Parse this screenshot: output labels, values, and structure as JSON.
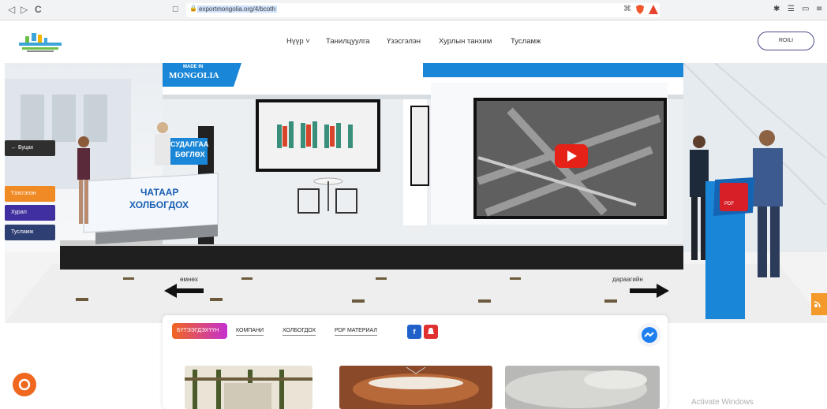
{
  "browser": {
    "url": "exportmongolia.org/4/bcoth",
    "back_glyph": "◁",
    "forward_glyph": "▷",
    "reload_glyph": "C"
  },
  "header": {
    "nav": [
      {
        "label": "Нүүр ˅"
      },
      {
        "label": "Танилцуулга"
      },
      {
        "label": "Үзэсгэлэн"
      },
      {
        "label": "Хурлын танхим"
      },
      {
        "label": "Тусламж"
      }
    ],
    "login_label": "ROILI"
  },
  "booth": {
    "banner_top": "MADE IN",
    "banner_main": "MONGOLIA",
    "research_line1": "СУДАЛГАА",
    "research_line2": "БӨГЛӨХ",
    "contact_line1": "ЧАТААР",
    "contact_line2": "ХОЛБОГДОХ",
    "pdf_label": "PDF",
    "prev_label": "өмнөх",
    "next_label": "дараагийн"
  },
  "sidebar": {
    "back_label": "← Буцах",
    "items": [
      {
        "label": "Үзэсгэлэн",
        "color": "#f08a24"
      },
      {
        "label": "Хурал",
        "color": "#3f2fa0"
      },
      {
        "label": "Тусламж",
        "color": "#2e3f73"
      }
    ]
  },
  "tabs": [
    {
      "label": "БҮТЭЭГДЭХҮҮН"
    },
    {
      "label": "КОМПАНИ"
    },
    {
      "label": "ХОЛБОГДОХ"
    },
    {
      "label": "PDF МАТЕРИАЛ"
    }
  ],
  "windows_watermark": "Activate Windows",
  "colors": {
    "accent_orange": "#f08a24",
    "brand_blue": "#1a86d8",
    "tab_active_start": "#f0671f",
    "tab_active_end": "#c52fd0"
  }
}
